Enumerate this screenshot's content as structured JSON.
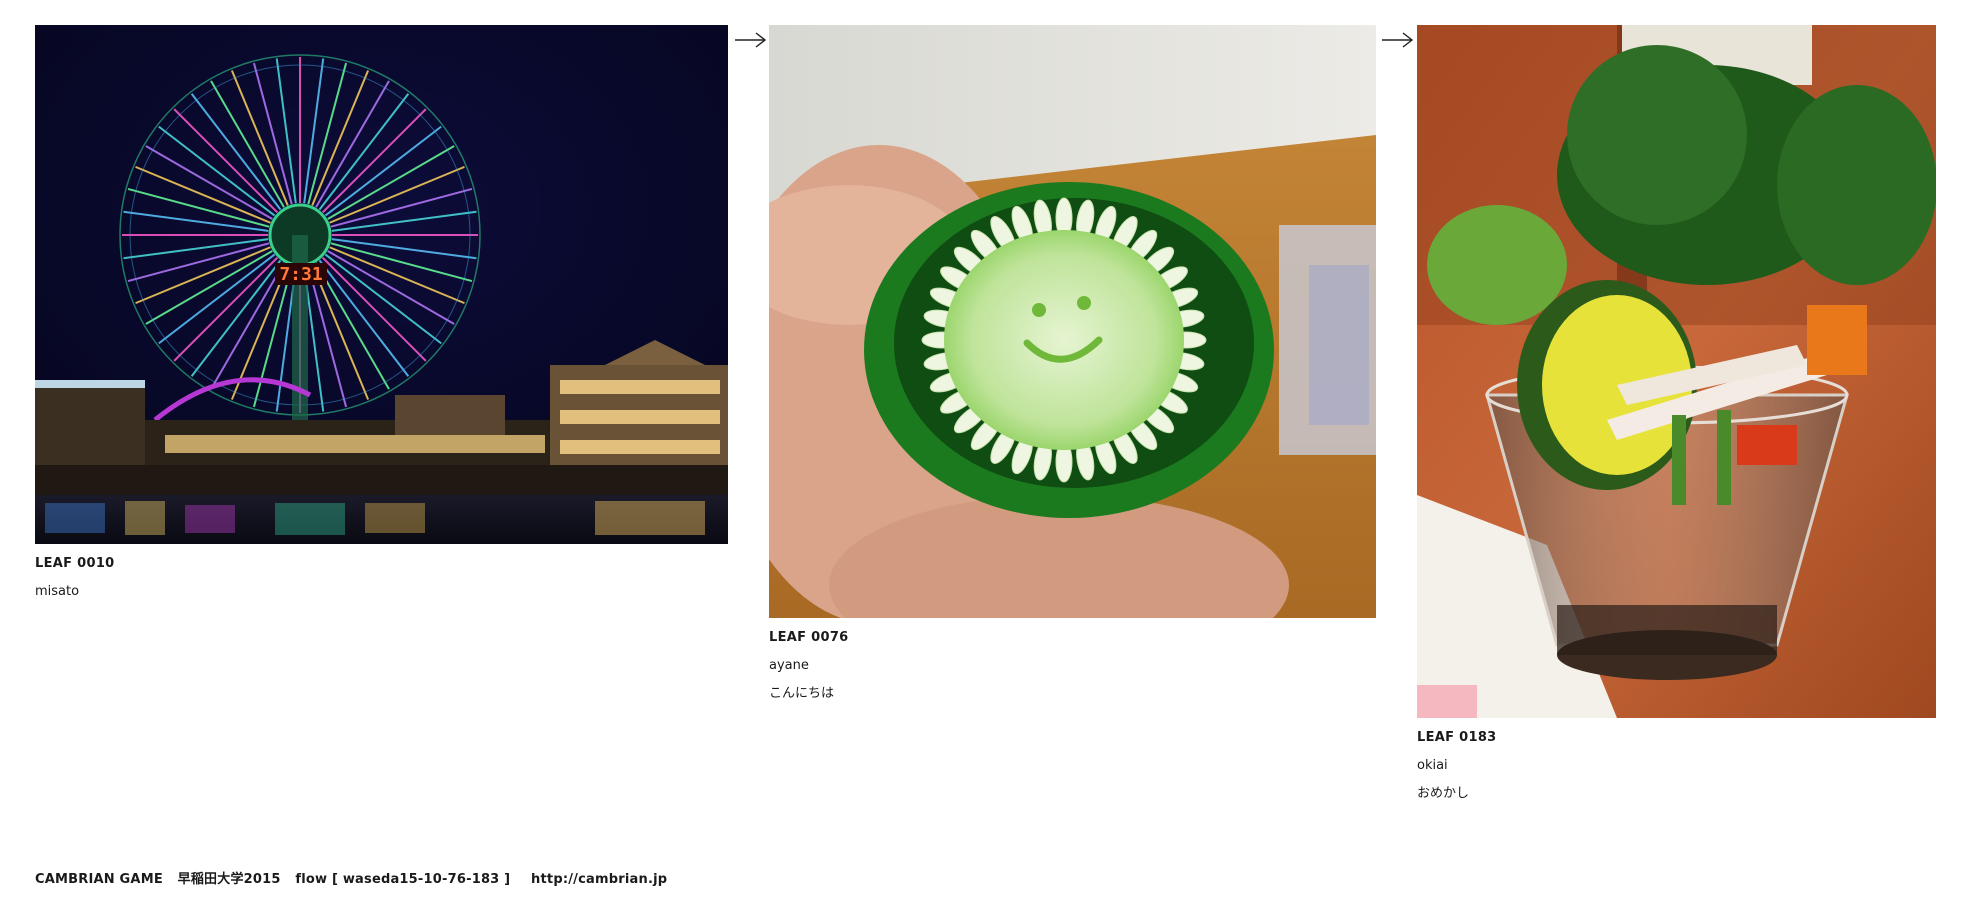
{
  "leaves": [
    {
      "id": "LEAF 0010",
      "user": "misato",
      "message": ""
    },
    {
      "id": "LEAF 0076",
      "user": "ayane",
      "message": "こんにちは"
    },
    {
      "id": "LEAF 0183",
      "user": "okiai",
      "message": "おめかし"
    }
  ],
  "photos": {
    "ferris_wheel_clock": "7:31"
  },
  "footer": {
    "title": "CAMBRIAN GAME",
    "event": "早稲田大学2015",
    "flow": "flow [ waseda15-10-76-183 ]",
    "url": "http://cambrian.jp"
  },
  "icons": {
    "flow_arrow": "right-arrow-icon"
  }
}
